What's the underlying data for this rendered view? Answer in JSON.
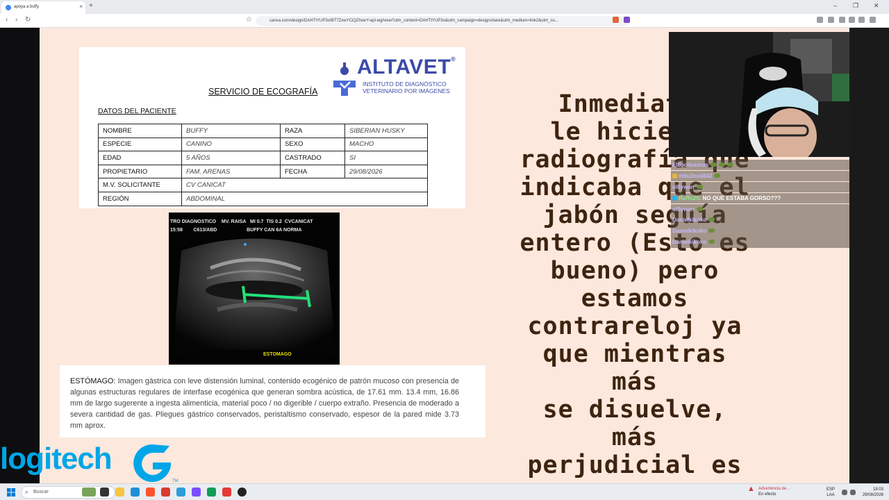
{
  "browser": {
    "tab_title": "apoya a buffy",
    "tab_close": "×",
    "new_tab": "+",
    "url": "canva.com/design/DAHTtYUP3o/BT7ZxwYCiQZhxwY-epl-wg/view?utm_content=DAHTtYUP3o&utm_campaign=designshare&utm_medium=link2&utm_so...",
    "win_min": "–",
    "win_max": "❐",
    "win_close": "✕"
  },
  "report": {
    "logo_name": "ALTAVET",
    "logo_reg": "®",
    "logo_sub1": "INSTITUTO DE DIAGNÓSTICO",
    "logo_sub2": "VETERINARIO POR IMÁGENES",
    "title": "SERVICIO DE ECOGRAFÍA",
    "section": "DATOS DEL PACIENTE",
    "rows": [
      {
        "k1": "NOMBRE",
        "v1": "BUFFY",
        "k2": "RAZA",
        "v2": "SIBERIAN HUSKY"
      },
      {
        "k1": "ESPECIE",
        "v1": "CANINO",
        "k2": "SEXO",
        "v2": "MACHO"
      },
      {
        "k1": "EDAD",
        "v1": "5 AÑOS",
        "k2": "CASTRADO",
        "v2": "SI"
      },
      {
        "k1": "PROPIETARIO",
        "v1": "FAM. ARENAS",
        "k2": "FECHA",
        "v2": "29/08/2026"
      },
      {
        "k1": "M.V. SOLICITANTE",
        "v1": "CV CANICAT"
      },
      {
        "k1": "REGIÓN",
        "v1": "ABDOMINAL"
      }
    ]
  },
  "ultrasound": {
    "header_line1": "TRO DIAGNOSTICO    MV. RAISA   MI 0.7  TIS 0.2  CVCANICAT",
    "header_line2": "15:58        C613/ABD                      BUFFY CAN 6A NORMA",
    "label": "ESTOMAGO"
  },
  "description": {
    "heading": "ESTÓMAGO:",
    "text": " Imagen gástrica con leve distensión luminal, contenido ecogénico de patrón mucoso con presencia de algunas estructuras regulares de interfase ecogénica que generan sombra acústica, de 17.61 mm. 13.4 mm, 16.86 mm de largo sugerente a ingesta alimenticia, material poco / no digerible / cuerpo extraño. Presencia de moderado a severa cantidad de gas. Pliegues gástrico conservados, peristaltismo conservado, espesor de la pared mide 3.73 mm aprox."
  },
  "big_text": {
    "lines": [
      "Inmediatan",
      "le hicieron",
      "radiografía que",
      "indicaba que el",
      "jabón seguía",
      "entero (Esto es",
      "bueno) pero",
      "estamos",
      "contrareloj ya",
      "que mientras más",
      "se disuelve, más",
      "perjudicial es"
    ]
  },
  "overlay": {
    "brand": "logitech",
    "tm": "TM"
  },
  "chat": {
    "messages": [
      {
        "user": "Elbaciloxeros",
        "text": ""
      },
      {
        "user": "m6u2oxd842",
        "text": ""
      },
      {
        "user": "olllywan",
        "text": ""
      },
      {
        "user": "Ruffo25",
        "text": ": NO QUE ESTABA GORSO???"
      },
      {
        "user": "olllywan",
        "text": ""
      },
      {
        "user": "Danielkikoko",
        "text": ""
      },
      {
        "user": "Danielkikoko",
        "text": ""
      },
      {
        "user": "Danielkikoko",
        "text": ""
      }
    ]
  },
  "taskbar": {
    "search_placeholder": "Buscar",
    "warn_title": "Advertencia de...",
    "warn_sub": "En efecto",
    "lang1": "ESP",
    "lang2": "LAA",
    "time": "18:03",
    "date": "29/08/2026"
  },
  "colors": {
    "slide_bg": "#fce8dd",
    "brand_blue": "#3b4aa7",
    "big_text": "#3e2410",
    "logitech": "#00a6e8",
    "measure_green": "#22e07a"
  }
}
